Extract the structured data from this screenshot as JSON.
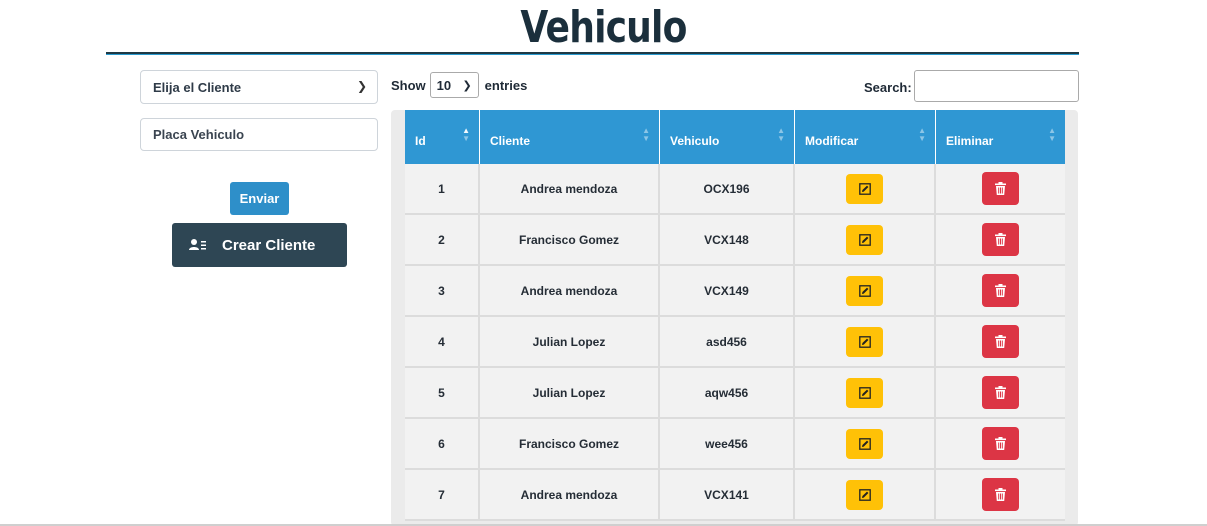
{
  "page": {
    "title": "Vehiculo"
  },
  "form": {
    "client_select": {
      "selected": "Elija el Cliente",
      "icon": "chevron-down-icon"
    },
    "plate_input": {
      "placeholder": "Placa Vehiculo",
      "value": ""
    },
    "send_label": "Enviar",
    "create_client": {
      "label": "Crear Cliente",
      "icon": "user-list-icon"
    }
  },
  "table_controls": {
    "show_label": "Show",
    "length_value": "10",
    "entries_label": "entries",
    "search_label": "Search:",
    "search_value": ""
  },
  "table": {
    "columns": [
      "Id",
      "Cliente",
      "Vehiculo",
      "Modificar",
      "Eliminar"
    ],
    "rows": [
      {
        "id": "1",
        "cliente": "Andrea mendoza",
        "vehiculo": "OCX196"
      },
      {
        "id": "2",
        "cliente": "Francisco Gomez",
        "vehiculo": "VCX148"
      },
      {
        "id": "3",
        "cliente": "Andrea mendoza",
        "vehiculo": "VCX149"
      },
      {
        "id": "4",
        "cliente": "Julian Lopez",
        "vehiculo": "asd456"
      },
      {
        "id": "5",
        "cliente": "Julian Lopez",
        "vehiculo": "aqw456"
      },
      {
        "id": "6",
        "cliente": "Francisco Gomez",
        "vehiculo": "wee456"
      },
      {
        "id": "7",
        "cliente": "Andrea mendoza",
        "vehiculo": "VCX141"
      }
    ]
  },
  "colors": {
    "header_blue": "#2f97d3",
    "edit_yellow": "#ffc107",
    "delete_red": "#dc3545",
    "dark_button": "#2e4654"
  }
}
